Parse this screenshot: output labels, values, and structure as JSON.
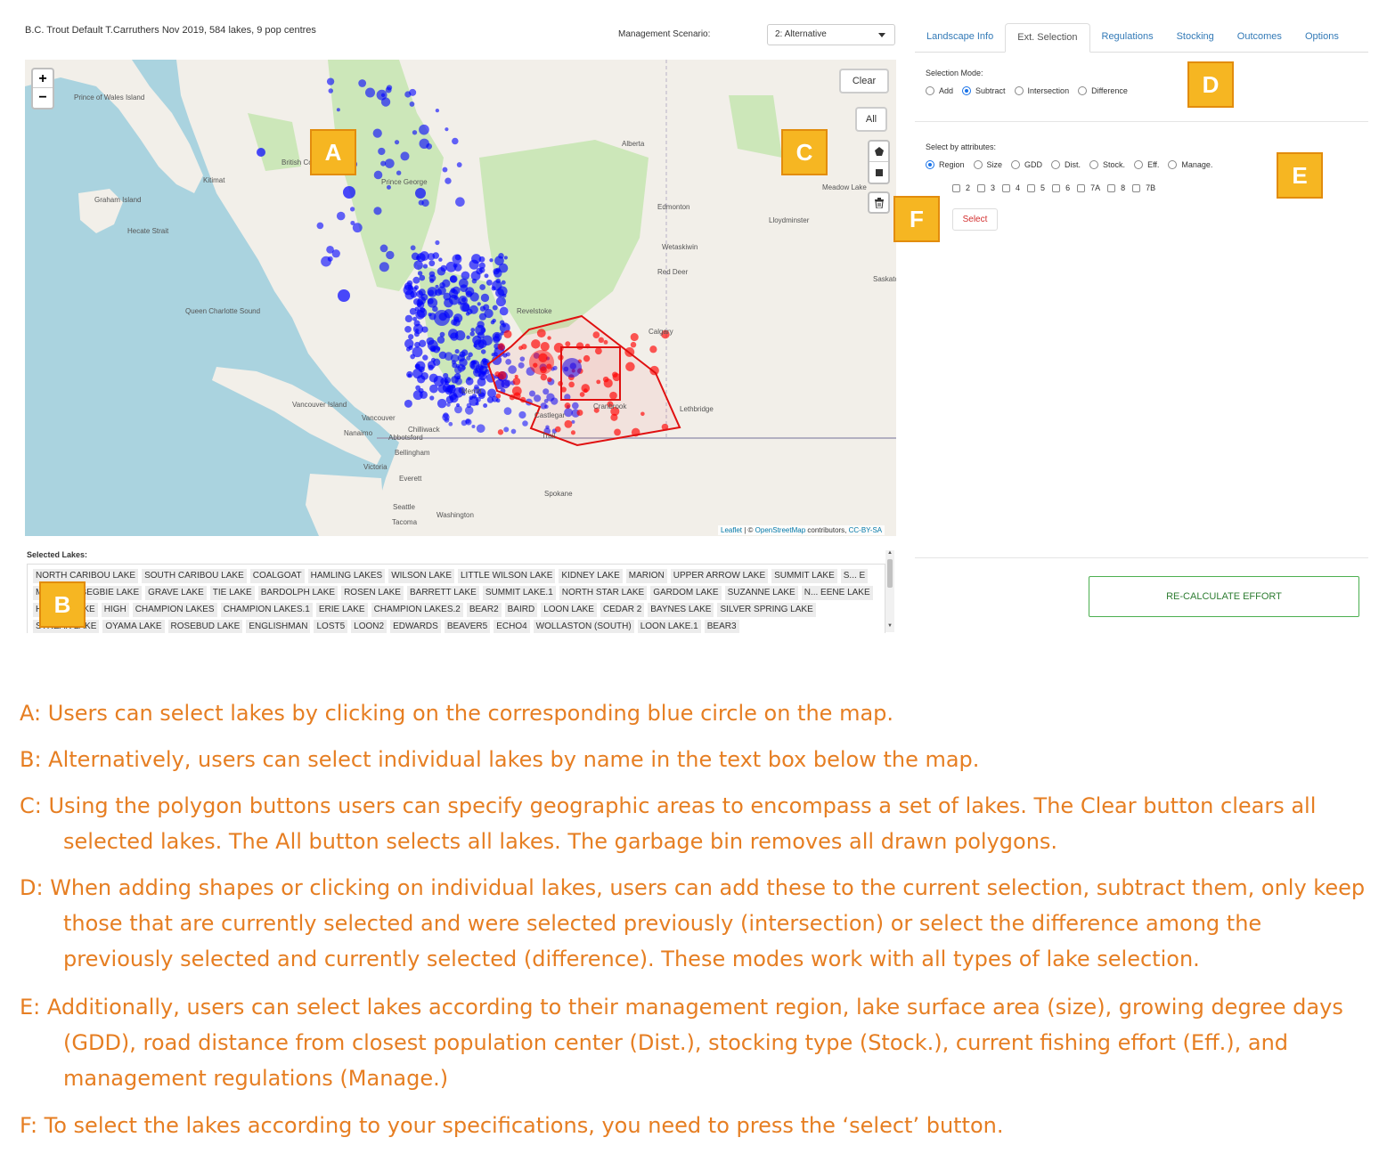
{
  "header": {
    "model_title": "B.C. Trout Default T.Carruthers Nov 2019, 584 lakes, 9 pop centres",
    "scenario_label": "Management Scenario:",
    "scenario_value": "2: Alternative"
  },
  "map": {
    "zoom_in": "+",
    "zoom_out": "−",
    "clear_label": "Clear",
    "all_label": "All",
    "attribution_prefix": "Leaflet",
    "attribution_sep": " | © ",
    "attribution_osm": "OpenStreetMap",
    "attribution_mid": " contributors, ",
    "attribution_license": "CC-BY-SA",
    "place_labels": [
      "Prince of Wales Island",
      "Graham Island",
      "Hecate Strait",
      "Queen Charlotte Sound",
      "Vancouver Island",
      "Kitimat",
      "British Co",
      "Prince George",
      "Alberta",
      "Edmonton",
      "Lloydminster",
      "Meadow Lake",
      "Wetaskiwin",
      "Red Deer",
      "Saskato",
      "Calgary",
      "Lethbridge",
      "Revelstoke",
      "Merritt",
      "Cranbrook",
      "Castlegar",
      "Trail",
      "Vancouver",
      "Nanaimo",
      "Abbotsford",
      "Chilliwack",
      "Bellingham",
      "Victoria",
      "Everett",
      "Seattle",
      "Tacoma",
      "Washington",
      "Spokane"
    ],
    "colors": {
      "selected": "#0000ff",
      "subtracted": "#ff0000",
      "polygon": "#e01010",
      "land": "#f2efe9",
      "water": "#aad3df",
      "park": "#c8e6b4"
    }
  },
  "selected_lakes": {
    "label": "Selected Lakes:",
    "names": [
      "NORTH CARIBOU LAKE",
      "SOUTH CARIBOU LAKE",
      "COALGOAT",
      "HAMLING LAKES",
      "WILSON LAKE",
      "LITTLE WILSON LAKE",
      "KIDNEY LAKE",
      "MARION",
      "UPPER ARROW LAKE",
      "SUMMIT LAKE",
      "S... E",
      "MIRROR",
      "BEGBIE LAKE",
      "GRAVE LAKE",
      "TIE LAKE",
      "BARDOLPH LAKE",
      "ROSEN LAKE",
      "BARRETT LAKE",
      "SUMMIT LAKE.1",
      "NORTH STAR LAKE",
      "GARDOM LAKE",
      "SUZANNE LAKE",
      "N... EENE LAKE",
      "HIDDEN LAKE",
      "HIGH",
      "CHAMPION LAKES",
      "CHAMPION LAKES.1",
      "ERIE LAKE",
      "CHAMPION LAKES.2",
      "BEAR2",
      "BAIRD",
      "LOON LAKE",
      "CEDAR 2",
      "BAYNES LAKE",
      "SILVER SPRING LAKE",
      "STREAK LAKE",
      "OYAMA LAKE",
      "ROSEBUD LAKE",
      "ENGLISHMAN",
      "LOST5",
      "LOON2",
      "EDWARDS",
      "BEAVER5",
      "ECHO4",
      "WOLLASTON (SOUTH)",
      "LOON LAKE.1",
      "BEAR3"
    ]
  },
  "tabs": [
    "Landscape Info",
    "Ext. Selection",
    "Regulations",
    "Stocking",
    "Outcomes",
    "Options"
  ],
  "selection_mode": {
    "label": "Selection Mode:",
    "options": [
      "Add",
      "Subtract",
      "Intersection",
      "Difference"
    ],
    "selected": "Subtract"
  },
  "attributes": {
    "label": "Select by attributes:",
    "options": [
      "Region",
      "Size",
      "GDD",
      "Dist.",
      "Stock.",
      "Eff.",
      "Manage."
    ],
    "selected": "Region",
    "regions": [
      "2",
      "3",
      "4",
      "5",
      "6",
      "7A",
      "8",
      "7B"
    ],
    "select_button": "Select"
  },
  "recalc_button": "RE-CALCULATE EFFORT",
  "callouts": [
    "A",
    "B",
    "C",
    "D",
    "E",
    "F"
  ],
  "annotations": [
    "A: Users can select lakes by clicking on the corresponding blue circle on the map.",
    "B: Alternatively, users can select individual lakes by name in the text box below the map.",
    "C: Using the polygon buttons users can specify geographic areas to encompass a set of lakes. The Clear button clears all selected lakes. The All button selects all lakes. The garbage bin removes all drawn polygons.",
    "D: When adding shapes or clicking on individual lakes, users can add these to the current selection, subtract them, only keep those that are currently selected and were selected previously (intersection) or select the difference among the previously selected and currently selected (difference). These modes work with all types of lake selection.",
    "E: Additionally, users can select lakes according to their management region, lake surface area (size), growing degree days (GDD), road distance from closest population center (Dist.), stocking type (Stock.), current fishing effort (Eff.), and management regulations (Manage.)",
    "F: To select the lakes according to your specifications, you need to press the ‘select’ button."
  ]
}
